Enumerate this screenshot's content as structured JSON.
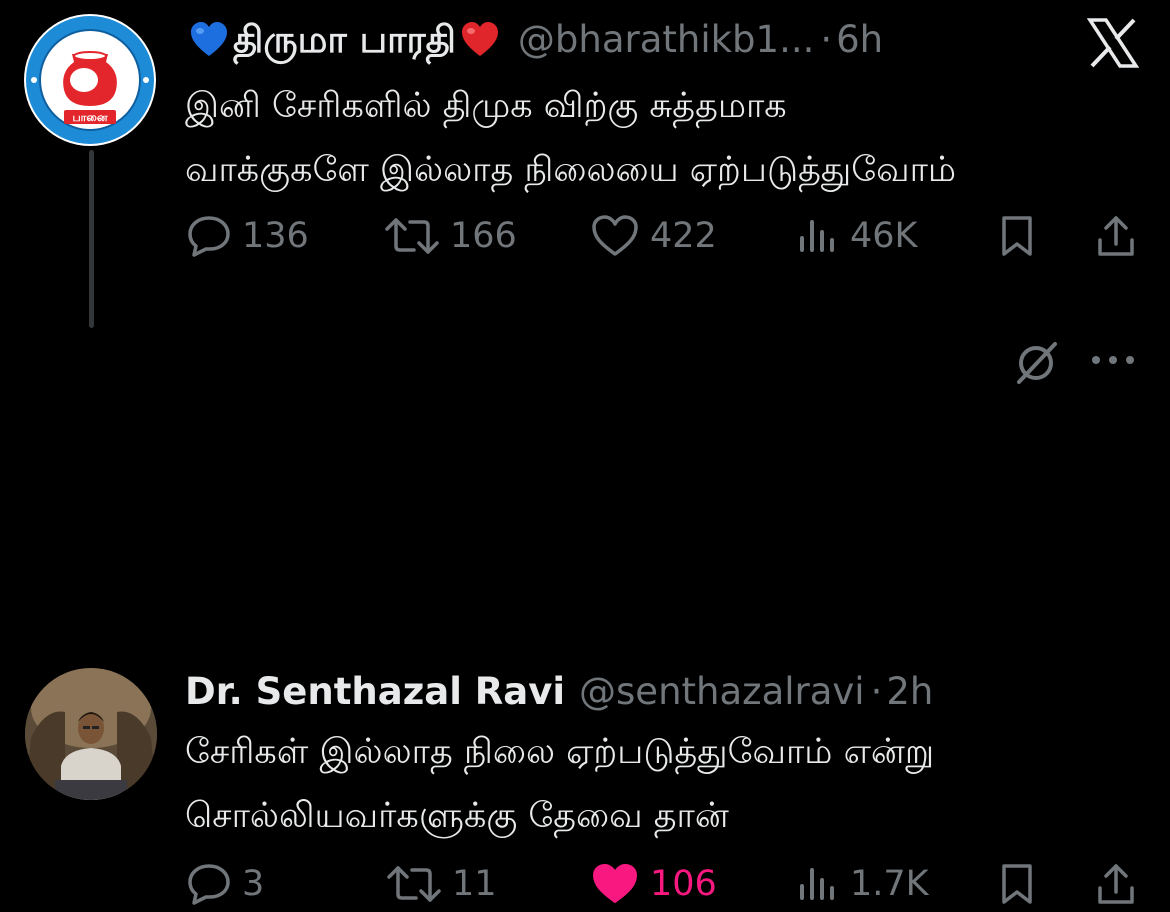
{
  "tweet1": {
    "display_name": "திருமா பாரதி",
    "handle": "@bharathikb1...",
    "separator": "·",
    "time": "6h",
    "avatar_text": "பானை",
    "body_line1": "இனி சேரிகளில் திமுக விற்கு சுத்தமாக",
    "body_line2": "வாக்குகளே இல்லாத நிலையை ஏற்படுத்துவோம்",
    "replies": "136",
    "reposts": "166",
    "likes": "422",
    "views": "46K"
  },
  "tweet2": {
    "display_name": "Dr. Senthazal Ravi",
    "handle": "@senthazalravi",
    "separator": "·",
    "time": "2h",
    "body_line1": "சேரிகள் இல்லாத நிலை ஏற்படுத்துவோம் என்று",
    "body_line2": "சொல்லியவர்களுக்கு தேவை தான்",
    "replies": "3",
    "reposts": "11",
    "likes": "106",
    "views": "1.7K",
    "liked": true
  },
  "colors": {
    "background": "#000000",
    "text": "#e7e9ea",
    "muted": "#71767b",
    "like": "#f91880",
    "heart_blue": "#1d6fe0",
    "heart_red": "#e0262b"
  }
}
